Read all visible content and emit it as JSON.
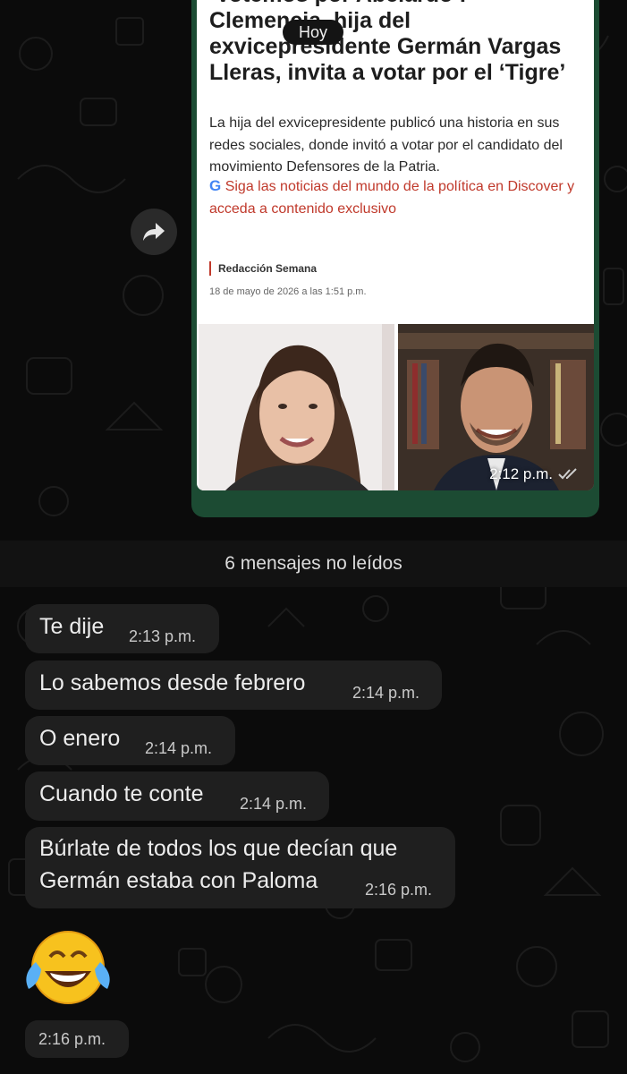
{
  "chat": {
    "day_label": "Hoy",
    "unread_banner": "6 mensajes no leídos"
  },
  "preview": {
    "headline": "‘Votemos por Abelardo’: Clemencia, hija del exvicepresidente Germán Vargas Lleras, invita a votar por el ‘Tigre’",
    "lead": "La hija del exvicepresidente publicó una historia en sus redes sociales, donde invitó a votar por el candidato del movimiento Defensores de la Patria.",
    "discover_logo": "G",
    "discover_text": "Siga las noticias del mundo de la política en Discover y acceda a contenido exclusivo",
    "byline": "Redacción Semana",
    "date": "18 de mayo de 2026 a las 1:51 p.m.",
    "time": "2:12 p.m.",
    "images": [
      "woman-portrait",
      "man-portrait"
    ]
  },
  "messages": [
    {
      "text": "Te dije",
      "time": "2:13 p.m."
    },
    {
      "text": "Lo sabemos desde febrero",
      "time": "2:14 p.m."
    },
    {
      "text": "O enero",
      "time": "2:14 p.m."
    },
    {
      "text": "Cuando te conte",
      "time": "2:14 p.m."
    },
    {
      "text_line1": "Búrlate de todos los que decían que",
      "text_line2": "Germán estaba con Paloma",
      "time": "2:16 p.m."
    }
  ],
  "emoji_message": {
    "emoji": "face-with-tears-of-joy",
    "time": "2:16 p.m."
  },
  "colors": {
    "background": "#0b0b0b",
    "bubble_incoming": "#1f1f1f",
    "bubble_outgoing": "#1c4b33",
    "discover_red": "#c0392b"
  }
}
